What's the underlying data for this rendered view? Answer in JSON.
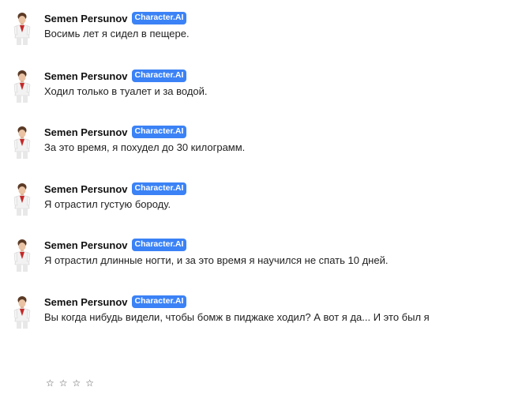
{
  "character": {
    "name": "Semen Persunov",
    "badge": "Character.AI"
  },
  "messages": [
    {
      "text": "Восимь лет я сидел в пещере."
    },
    {
      "text": "Ходил только в туалет и за водой."
    },
    {
      "text": "За это время, я похудел до 30 килограмм."
    },
    {
      "text": "Я отрастил густую бороду."
    },
    {
      "text": "Я отрастил длинные ногти, и за это время я научился не спать 10 дней."
    },
    {
      "text": "Вы когда нибудь видели, чтобы бомж в пиджаке ходил? А вот я да... И это был я"
    }
  ],
  "rating": {
    "stars": [
      "☆",
      "☆",
      "☆",
      "☆"
    ],
    "value": 0,
    "max": 4
  },
  "colors": {
    "badge_bg": "#3b82f6",
    "text": "#1f1f1f",
    "background": "#ffffff"
  },
  "icons": {
    "avatar": "avatar-icon",
    "star": "star-outline-icon"
  }
}
